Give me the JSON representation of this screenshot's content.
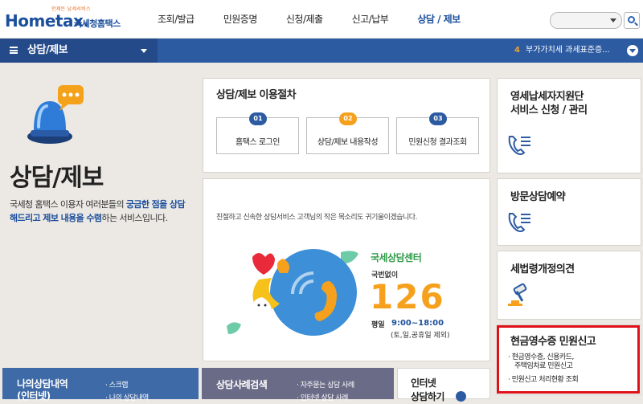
{
  "header": {
    "logo_tagline": "언제든 납세서비스",
    "logo_main": "Hometax.",
    "logo_sub": "국세청홈택스",
    "nav": [
      "조회/발급",
      "민원증명",
      "신청/제출",
      "신고/납부",
      "상담 / 제보"
    ],
    "search_value": ""
  },
  "subbar": {
    "title": "상담/제보",
    "notice_number": "4",
    "notice_text": "부가가치세 과세표준증..."
  },
  "intro": {
    "title": "상담/제보",
    "desc_1": "국세청 홈택스 이용자 여러분들의 ",
    "desc_hl_1": "궁금한 점을 상담해드리고 제보 내용을 수렴",
    "desc_2": "하는 서비스입니다."
  },
  "procedure": {
    "title": "상담/제보 이용절차",
    "steps": [
      {
        "num": "01",
        "label": "홈택스 로그인"
      },
      {
        "num": "02",
        "label": "상담/제보 내용작성"
      },
      {
        "num": "03",
        "label": "민원신청 결과조회"
      }
    ]
  },
  "center": {
    "greeting": "친절하고 신속한 상담서비스 고객님의 작은 목소리도 귀기울이겠습니다.",
    "logo": "국세상담센터",
    "sub": "국번없이",
    "number": "126",
    "hours_label": "평일",
    "hours": "9:00~18:00",
    "hours_note": "(토,일,공휴일 제외)"
  },
  "right": {
    "card1_title_1": "영세납세자지원단",
    "card1_title_2": "서비스 신청 / 관리",
    "card2_title": "방문상담예약",
    "card3_title": "세법령개정의견",
    "card4_title": "현금영수증 민원신고",
    "card4_item1": "· 현금영수증, 신용카드,",
    "card4_item1b": "주택임차료 민원신고",
    "card4_item2": "· 민원신고 처리현황 조회"
  },
  "bottom": {
    "my_title_1": "나의상담내역",
    "my_title_2": "(인터넷)",
    "my_item1": "· 스크랩",
    "my_item2": "· 나의 상담내역",
    "case_title": "상담사례검색",
    "case_item1": "· 자주묻는 상담 사례",
    "case_item2": "· 인터넷 상담 사례",
    "net_title_1": "인터넷",
    "net_title_2": "상담하기"
  },
  "colors": {
    "brand_blue": "#1c4f9c",
    "accent_orange": "#f6a11d",
    "highlight_red": "#e0101a"
  }
}
